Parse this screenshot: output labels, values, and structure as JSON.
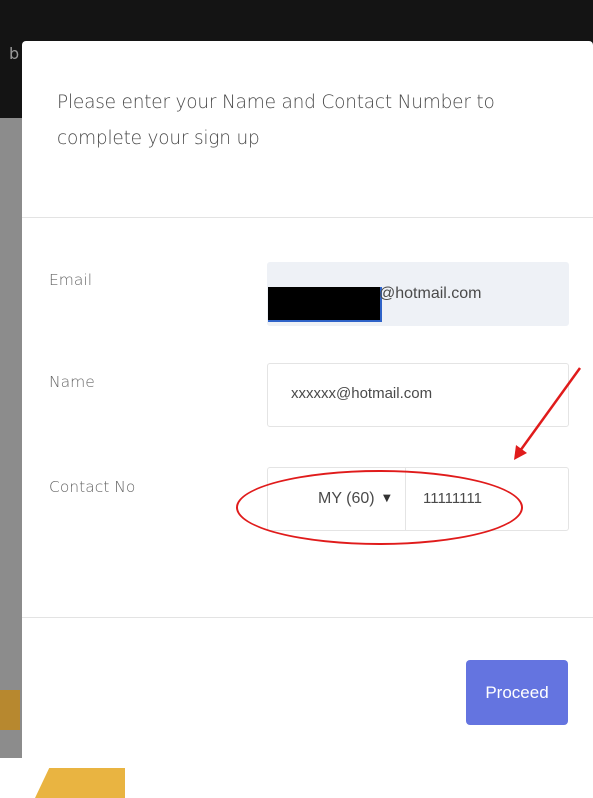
{
  "background": {
    "topbar_letter": "b"
  },
  "modal": {
    "title": "Please enter your Name and Contact Number to complete your sign up",
    "email": {
      "label": "Email",
      "value_suffix": "@hotmail.com"
    },
    "name": {
      "label": "Name",
      "value": "xxxxxx@hotmail.com"
    },
    "contact": {
      "label": "Contact No",
      "country_code": "MY (60)",
      "number": "11111111"
    },
    "proceed_label": "Proceed"
  },
  "colors": {
    "accent": "#6474e0",
    "annotation": "#e01b1b"
  }
}
